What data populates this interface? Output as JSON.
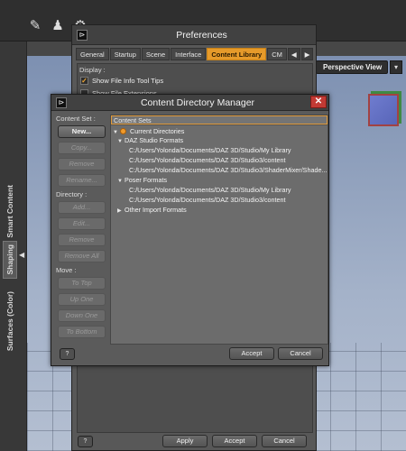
{
  "left_panel": {
    "tabs": [
      {
        "label": "Smart Content",
        "active": false
      },
      {
        "label": "Shaping",
        "active": true
      },
      {
        "label": "Surfaces (Color)",
        "active": false
      }
    ]
  },
  "viewport": {
    "camera_label": "Perspective View"
  },
  "preferences": {
    "title": "Preferences",
    "tabs": [
      "General",
      "Startup",
      "Scene",
      "Interface",
      "Content Library",
      "CM"
    ],
    "active_tab": "Content Library",
    "display_group_label": "Display :",
    "options": [
      {
        "label": "Show File Info Tool Tips",
        "checked": true
      },
      {
        "label": "Show File Extensions",
        "checked": false
      }
    ],
    "footer": {
      "help_label": "?",
      "apply_label": "Apply",
      "accept_label": "Accept",
      "cancel_label": "Cancel"
    }
  },
  "cdm": {
    "title": "Content Directory Manager",
    "close_label": "✕",
    "content_set_label": "Content Set :",
    "new_label": "New...",
    "copy_label": "Copy...",
    "remove_label": "Remove",
    "rename_label": "Rename...",
    "directory_label": "Directory :",
    "add_label": "Add...",
    "edit_label": "Edit...",
    "remove_dir_label": "Remove",
    "remove_all_label": "Remove All",
    "move_label": "Move :",
    "to_top_label": "To Top",
    "up_one_label": "Up One",
    "down_one_label": "Down One",
    "to_bottom_label": "To Bottom",
    "tree_header": "Content Sets",
    "tree": {
      "current": "Current Directories",
      "daz_formats": "DAZ Studio Formats",
      "daz_paths": [
        "C:/Users/Yolonda/Documents/DAZ 3D/Studio/My Library",
        "C:/Users/Yolonda/Documents/DAZ 3D/Studio3/content",
        "C:/Users/Yolonda/Documents/DAZ 3D/Studio3/ShaderMixer/Shade..."
      ],
      "poser_formats": "Poser Formats",
      "poser_paths": [
        "C:/Users/Yolonda/Documents/DAZ 3D/Studio/My Library",
        "C:/Users/Yolonda/Documents/DAZ 3D/Studio3/content"
      ],
      "other_formats": "Other Import Formats"
    },
    "help_label": "?",
    "accept_label": "Accept",
    "cancel_label": "Cancel"
  }
}
